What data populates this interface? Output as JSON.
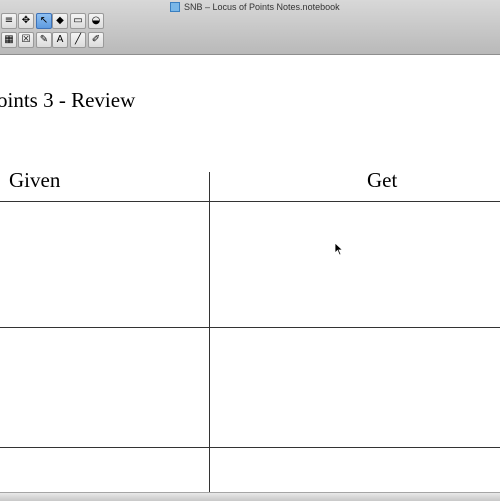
{
  "window": {
    "title": "SNB – Locus of Points Notes.notebook"
  },
  "toolbar": {
    "tools": [
      {
        "name": "pen-tools-icon",
        "glyph": "≡",
        "active": false
      },
      {
        "name": "magic-pen-icon",
        "glyph": "✥",
        "active": false
      },
      {
        "name": "select-arrow-icon",
        "glyph": "↖",
        "active": true
      },
      {
        "name": "shapes-icon",
        "glyph": "◆",
        "active": false
      },
      {
        "name": "eraser-icon",
        "glyph": "▭",
        "active": false
      },
      {
        "name": "fill-icon",
        "glyph": "◒",
        "active": false
      },
      {
        "name": "table-icon",
        "glyph": "▦",
        "active": false
      },
      {
        "name": "close-box-icon",
        "glyph": "☒",
        "active": false
      },
      {
        "name": "creative-pen-icon",
        "glyph": "✎",
        "active": false
      },
      {
        "name": "text-icon",
        "glyph": "A",
        "active": false
      },
      {
        "name": "line-icon",
        "glyph": "╱",
        "active": false
      },
      {
        "name": "highlighter-icon",
        "glyph": "✐",
        "active": false
      }
    ]
  },
  "page": {
    "heading": "oints 3 - Review",
    "table": {
      "columns": [
        "Given",
        "Get"
      ],
      "rows": [
        [
          "",
          ""
        ],
        [
          "",
          ""
        ],
        [
          "",
          ""
        ]
      ]
    }
  },
  "colors": {
    "toolbar_active": "#6aa6e6",
    "grid_line": "#333333"
  }
}
